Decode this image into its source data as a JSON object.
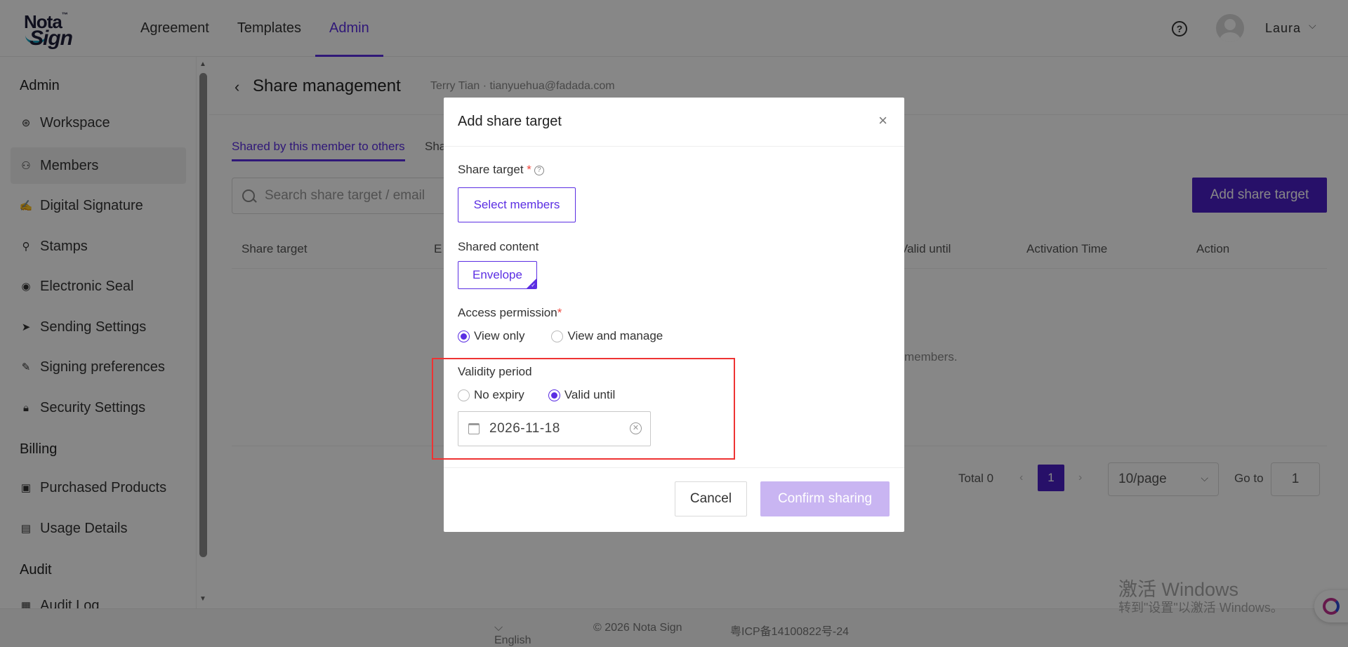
{
  "brand": {
    "logo_top": "Nota",
    "logo_tm": "™",
    "logo_bottom": "Sign"
  },
  "topnav": {
    "items": [
      {
        "label": "Agreement"
      },
      {
        "label": "Templates"
      },
      {
        "label": "Admin"
      }
    ]
  },
  "user": {
    "name": "Laura",
    "help_icon": "?"
  },
  "sidebar": {
    "sections": [
      {
        "label": "Admin"
      },
      {
        "label": "Billing"
      },
      {
        "label": "Audit"
      }
    ],
    "items": [
      {
        "label": "Workspace",
        "icon": "workspace-icon"
      },
      {
        "label": "Members",
        "icon": "members-icon",
        "active": true
      },
      {
        "label": "Digital Signature",
        "icon": "signature-icon"
      },
      {
        "label": "Stamps",
        "icon": "stamp-icon"
      },
      {
        "label": "Electronic Seal",
        "icon": "seal-icon"
      },
      {
        "label": "Sending Settings",
        "icon": "send-icon"
      },
      {
        "label": "Signing preferences",
        "icon": "pen-icon"
      },
      {
        "label": "Security Settings",
        "icon": "lock-icon"
      },
      {
        "label": "Purchased Products",
        "icon": "product-icon"
      },
      {
        "label": "Usage Details",
        "icon": "document-icon"
      },
      {
        "label": "Audit Log",
        "icon": "log-icon"
      }
    ]
  },
  "page": {
    "title": "Share management",
    "subtitle": "Terry Tian · tianyuehua@fadada.com",
    "tabs": [
      {
        "label": "Shared by this member to others"
      },
      {
        "label": "Sha"
      }
    ],
    "search_placeholder": "Search share target / email",
    "add_button": "Add share target",
    "table_headers": [
      "Share target",
      "E",
      "Valid until",
      "Activation Time",
      "Action"
    ],
    "empty_text": "members.",
    "pagination": {
      "total": "Total 0",
      "current_page": "1",
      "page_size": "10/page",
      "goto_label": "Go to",
      "goto_value": "1"
    }
  },
  "modal": {
    "title": "Add share target",
    "share_target_label": "Share target",
    "required_mark": "*",
    "select_members": "Select members",
    "shared_content_label": "Shared content",
    "envelope_tag": "Envelope",
    "access_label": "Access permission",
    "access_options": [
      {
        "label": "View only",
        "checked": true
      },
      {
        "label": "View and manage",
        "checked": false
      }
    ],
    "validity_label": "Validity period",
    "validity_options": [
      {
        "label": "No expiry",
        "checked": false
      },
      {
        "label": "Valid until",
        "checked": true
      }
    ],
    "date_value": "2026-11-18",
    "cancel": "Cancel",
    "confirm": "Confirm sharing"
  },
  "footer": {
    "language": "English",
    "copyright": "© 2026 Nota Sign",
    "icp": "粤ICP备14100822号-24"
  },
  "watermark": {
    "line1": "激活 Windows",
    "line2": "转到\"设置\"以激活 Windows。"
  },
  "colors": {
    "accent": "#5b2ee3",
    "primary_button": "#4b1fc7",
    "disabled_button": "#c9b5f2",
    "highlight": "#ee3333"
  }
}
